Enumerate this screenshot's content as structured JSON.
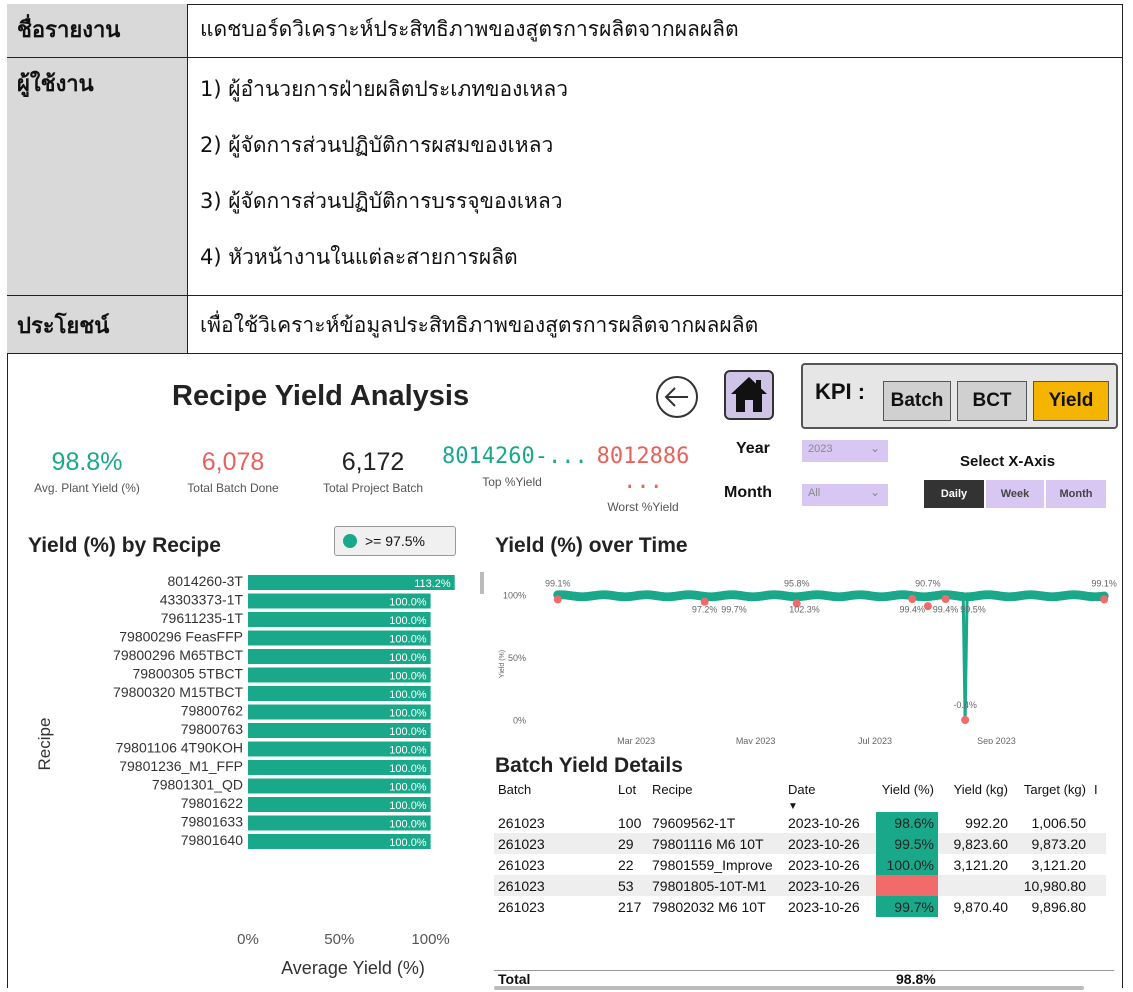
{
  "doc": {
    "rows": [
      {
        "label": "ชื่อรายงาน",
        "lines": [
          "แดชบอร์ดวิเคราะห์ประสิทธิภาพของสูตรการผลิตจากผลผลิต"
        ]
      },
      {
        "label": "ผู้ใช้งาน",
        "lines": [
          "1) ผู้อำนวยการฝ่ายผลิตประเภทของเหลว",
          "2) ผู้จัดการส่วนปฏิบัติการผสมของเหลว",
          "3) ผู้จัดการส่วนปฏิบัติการบรรจุของเหลว",
          "4) หัวหน้างานในแต่ละสายการผลิต"
        ]
      },
      {
        "label": "ประโยชน์",
        "lines": [
          "เพื่อใช้วิเคราะห์ข้อมูลประสิทธิภาพของสูตรการผลิตจากผลผลิต"
        ]
      }
    ]
  },
  "dashboard": {
    "title": "Recipe Yield Analysis",
    "back_icon": "arrow-left-circle-icon",
    "home_icon": "home-icon",
    "kpi_nav": {
      "label": "KPI :",
      "buttons": [
        "Batch",
        "BCT",
        "Yield"
      ],
      "active": "Yield",
      "active_color": "#f5b400"
    },
    "cards": [
      {
        "value": "98.8%",
        "label": "Avg. Plant Yield (%)",
        "color": "#1aa88a"
      },
      {
        "value": "6,078",
        "label": "Total Batch Done",
        "color": "#e8625c"
      },
      {
        "value": "6,172",
        "label": "Total Project Batch",
        "color": "#222222"
      },
      {
        "value": "8014260-...",
        "label": "Top %Yield",
        "color": "#1aa88a"
      },
      {
        "value": "8012886 ...",
        "label": "Worst %Yield",
        "color": "#e8625c"
      }
    ],
    "filters": {
      "year_label": "Year",
      "year_value": "2023",
      "month_label": "Month",
      "month_value": "All"
    },
    "xaxis": {
      "label": "Select X-Axis",
      "options": [
        "Daily",
        "Week",
        "Month"
      ],
      "active": "Daily"
    },
    "legend_badge": ">= 97.5%",
    "colors": {
      "teal": "#1aa88a",
      "red": "#f26b6b",
      "lavender": "#d9c7f3"
    }
  },
  "chart_data": [
    {
      "type": "bar",
      "title": "Yield (%) by Recipe",
      "ylabel": "Recipe",
      "xlabel": "Average Yield (%)",
      "xticks": [
        "0%",
        "50%",
        "100%"
      ],
      "xlim": [
        0,
        115
      ],
      "categories": [
        "8014260-3T",
        "43303373-1T",
        "79611235-1T",
        "79800296 FeasFFP",
        "79800296 M65TBCT",
        "79800305 5TBCT",
        "79800320 M15TBCT",
        "79800762",
        "79800763",
        "79801106 4T90KOH",
        "79801236_M1_FFP",
        "79801301_QD",
        "79801622",
        "79801633",
        "79801640"
      ],
      "values": [
        113.2,
        100.0,
        100.0,
        100.0,
        100.0,
        100.0,
        100.0,
        100.0,
        100.0,
        100.0,
        100.0,
        100.0,
        100.0,
        100.0,
        100.0
      ],
      "value_labels": [
        "113.2%",
        "100.0%",
        "100.0%",
        "100.0%",
        "100.0%",
        "100.0%",
        "100.0%",
        "100.0%",
        "100.0%",
        "100.0%",
        "100.0%",
        "100.0%",
        "100.0%",
        "100.0%",
        "100.0%"
      ]
    },
    {
      "type": "line",
      "title": "Yield (%) over Time",
      "ylabel": "Yield (%)",
      "yticks": [
        "100%",
        "50%",
        "0%"
      ],
      "ylim": [
        -10,
        110
      ],
      "xticks": [
        "Mar 2023",
        "May 2023",
        "Jul 2023",
        "Sep 2023"
      ],
      "labels": [
        {
          "text": "99.1%",
          "x": "2023-01-20",
          "y": 99.1
        },
        {
          "text": "97.2%",
          "x": "2023-04-05",
          "y": 97.2
        },
        {
          "text": "99.7%",
          "x": "2023-04-20",
          "y": 99.7
        },
        {
          "text": "95.8%",
          "x": "2023-05-22",
          "y": 95.8
        },
        {
          "text": "102.3%",
          "x": "2023-05-26",
          "y": 102.3
        },
        {
          "text": "99.4%",
          "x": "2023-07-20",
          "y": 99.4
        },
        {
          "text": "90.7%",
          "x": "2023-07-28",
          "y": 90.7
        },
        {
          "text": "99.4%",
          "x": "2023-08-06",
          "y": 99.4
        },
        {
          "text": "99.5%",
          "x": "2023-08-20",
          "y": 99.5
        },
        {
          "text": "-0.4%",
          "x": "2023-08-16",
          "y": -0.4
        },
        {
          "text": "99.1%",
          "x": "2023-10-26",
          "y": 99.1
        }
      ]
    }
  ],
  "table": {
    "title": "Batch Yield Details",
    "headers": [
      "Batch",
      "Lot",
      "Recipe",
      "Date",
      "Yield (%)",
      "Yield (kg)",
      "Target (kg)",
      "I"
    ],
    "rows": [
      {
        "batch": "261023",
        "lot": "100",
        "recipe": "79609562-1T",
        "date": "2023-10-26",
        "yield_pct": "98.6%",
        "yield_kg": "992.20",
        "target_kg": "1,006.50",
        "status": "good"
      },
      {
        "batch": "261023",
        "lot": "29",
        "recipe": "79801116 M6 10T",
        "date": "2023-10-26",
        "yield_pct": "99.5%",
        "yield_kg": "9,823.60",
        "target_kg": "9,873.20",
        "status": "good"
      },
      {
        "batch": "261023",
        "lot": "22",
        "recipe": "79801559_Improve",
        "date": "2023-10-26",
        "yield_pct": "100.0%",
        "yield_kg": "3,121.20",
        "target_kg": "3,121.20",
        "status": "good"
      },
      {
        "batch": "261023",
        "lot": "53",
        "recipe": "79801805-10T-M1",
        "date": "2023-10-26",
        "yield_pct": "",
        "yield_kg": "",
        "target_kg": "10,980.80",
        "status": "bad"
      },
      {
        "batch": "261023",
        "lot": "217",
        "recipe": "79802032 M6 10T",
        "date": "2023-10-26",
        "yield_pct": "99.7%",
        "yield_kg": "9,870.40",
        "target_kg": "9,896.80",
        "status": "good"
      }
    ],
    "total_label": "Total",
    "total_yield": "98.8%"
  }
}
